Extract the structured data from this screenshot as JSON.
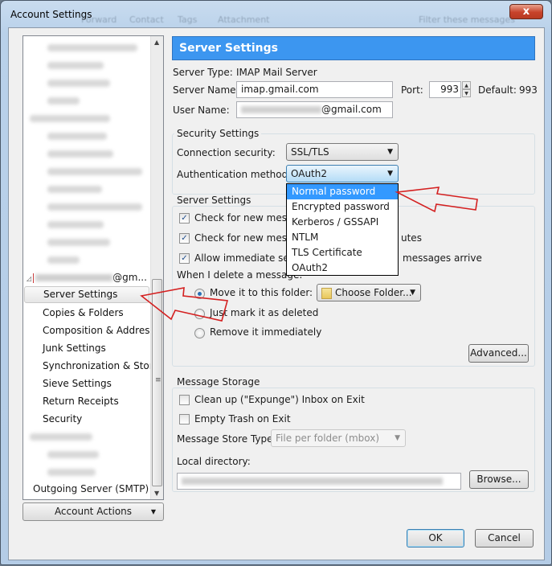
{
  "window": {
    "title": "Account Settings",
    "close_label": "x",
    "background_toolbar_ghost": [
      "Forward",
      "Contact",
      "Tags",
      "Attachment",
      "Filter these messages"
    ]
  },
  "sidebar": {
    "account_label": "@gm...",
    "items": [
      {
        "label": "Server Settings",
        "selected": true
      },
      {
        "label": "Copies & Folders"
      },
      {
        "label": "Composition & Addres..."
      },
      {
        "label": "Junk Settings"
      },
      {
        "label": "Synchronization & Stor..."
      },
      {
        "label": "Sieve Settings"
      },
      {
        "label": "Return Receipts"
      },
      {
        "label": "Security"
      }
    ],
    "outgoing_label": "Outgoing Server (SMTP)",
    "account_actions_label": "Account Actions"
  },
  "main": {
    "header": "Server Settings",
    "server_type_label": "Server Type:",
    "server_type_value": "IMAP Mail Server",
    "server_name_label": "Server Name:",
    "server_name_value": "imap.gmail.com",
    "port_label": "Port:",
    "port_value": "993",
    "default_label": "Default:",
    "default_value": "993",
    "user_name_label": "User Name:",
    "user_name_value": "@gmail.com",
    "security": {
      "group_title": "Security Settings",
      "connection_label": "Connection security:",
      "connection_value": "SSL/TLS",
      "auth_label": "Authentication method:",
      "auth_value": "OAuth2",
      "auth_options": [
        "Normal password",
        "Encrypted password",
        "Kerberos / GSSAPI",
        "NTLM",
        "TLS Certificate",
        "OAuth2"
      ],
      "auth_highlighted": "Normal password"
    },
    "server_settings": {
      "group_title": "Server Settings",
      "check_startup": {
        "label": "Check for new messag",
        "checked": true
      },
      "check_every": {
        "label": "Check for new messag",
        "suffix": "utes",
        "checked": true
      },
      "allow_push": {
        "label": "Allow immediate serv",
        "suffix": "messages arrive",
        "checked": true
      },
      "delete_label": "When I delete a message:",
      "radios": [
        {
          "label": "Move it to this folder:",
          "selected": true
        },
        {
          "label": "Just mark it as deleted",
          "selected": false
        },
        {
          "label": "Remove it immediately",
          "selected": false
        }
      ],
      "choose_folder_label": "Choose Folder...",
      "advanced_label": "Advanced..."
    },
    "storage": {
      "group_title": "Message Storage",
      "expunge": {
        "label": "Clean up (\"Expunge\") Inbox on Exit",
        "checked": false
      },
      "empty_trash": {
        "label": "Empty Trash on Exit",
        "checked": false
      },
      "store_type_label": "Message Store Type:",
      "store_type_value": "File per folder (mbox)",
      "local_dir_label": "Local directory:",
      "browse_label": "Browse..."
    }
  },
  "footer": {
    "ok_label": "OK",
    "cancel_label": "Cancel"
  },
  "annotation_color": "#d42020"
}
